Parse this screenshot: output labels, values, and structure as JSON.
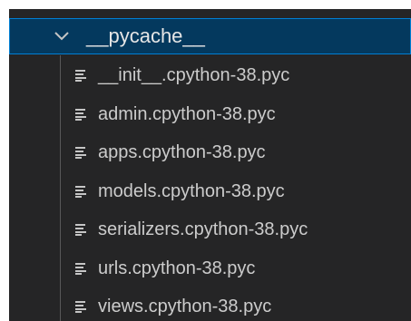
{
  "explorer": {
    "folder": {
      "name": "__pycache__",
      "expanded": true,
      "icon": "chevron-down-icon"
    },
    "files": [
      {
        "name": "__init__.cpython-38.pyc",
        "icon": "file-lines-icon"
      },
      {
        "name": "admin.cpython-38.pyc",
        "icon": "file-lines-icon"
      },
      {
        "name": "apps.cpython-38.pyc",
        "icon": "file-lines-icon"
      },
      {
        "name": "models.cpython-38.pyc",
        "icon": "file-lines-icon"
      },
      {
        "name": "serializers.cpython-38.pyc",
        "icon": "file-lines-icon"
      },
      {
        "name": "urls.cpython-38.pyc",
        "icon": "file-lines-icon"
      },
      {
        "name": "views.cpython-38.pyc",
        "icon": "file-lines-icon"
      }
    ]
  },
  "colors": {
    "background": "#252526",
    "selection_background": "#04395e",
    "selection_border": "#007fd4",
    "text": "#cccccc",
    "icon": "#c5c5c5"
  }
}
